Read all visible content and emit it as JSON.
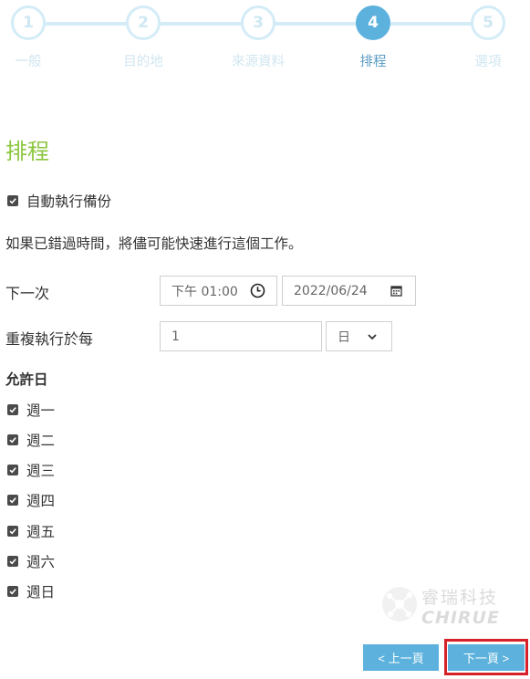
{
  "stepper": {
    "steps": [
      {
        "number": "1",
        "label": "一般"
      },
      {
        "number": "2",
        "label": "目的地"
      },
      {
        "number": "3",
        "label": "來源資料"
      },
      {
        "number": "4",
        "label": "排程"
      },
      {
        "number": "5",
        "label": "選項"
      }
    ],
    "active_step": 4
  },
  "schedule": {
    "title": "排程",
    "auto_backup": {
      "label": "自動執行備份",
      "checked": true
    },
    "missed_note": "如果已錯過時間，將儘可能快速進行這個工作。",
    "next_run": {
      "label": "下一次",
      "time": "下午 01:00",
      "date": "2022/06/24",
      "clock_icon": "clock-icon",
      "calendar_icon": "calendar-icon"
    },
    "repeat": {
      "label": "重複執行於每",
      "interval": "1",
      "unit": "日",
      "dropdown_icon": "chevron-down-icon"
    },
    "allowed_days": {
      "title": "允許日",
      "days": [
        {
          "label": "週一",
          "checked": true
        },
        {
          "label": "週二",
          "checked": true
        },
        {
          "label": "週三",
          "checked": true
        },
        {
          "label": "週四",
          "checked": true
        },
        {
          "label": "週五",
          "checked": true
        },
        {
          "label": "週六",
          "checked": true
        },
        {
          "label": "週日",
          "checked": true
        }
      ]
    }
  },
  "watermark": {
    "name": "睿瑞科技",
    "sub": "CHIRUE"
  },
  "footer": {
    "prev_label": "< 上一頁",
    "next_label": "下一頁 >"
  },
  "colors": {
    "accent": "#5cb2dd",
    "title_green": "#8cc63f",
    "focus_red": "#d6212a"
  }
}
